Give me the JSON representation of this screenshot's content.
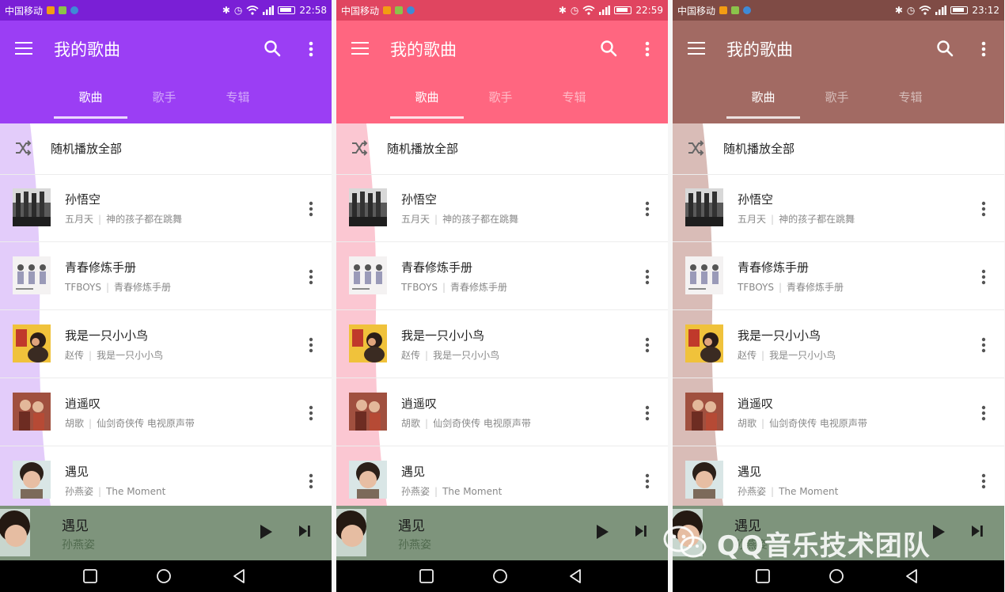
{
  "watermark": "QQ音乐技术团队",
  "phones": [
    {
      "theme": {
        "primary": "#9b3ef4",
        "status": "#7a1fd6",
        "wave": "#e3ccfa"
      },
      "status": {
        "carrier": "中国移动",
        "time": "22:58"
      },
      "toolbar": {
        "title": "我的歌曲"
      },
      "tabs": [
        "歌曲",
        "歌手",
        "专辑"
      ],
      "shuffle_label": "随机播放全部",
      "songs": [
        {
          "title": "孙悟空",
          "artist": "五月天",
          "album": "神的孩子都在跳舞"
        },
        {
          "title": "青春修炼手册",
          "artist": "TFBOYS",
          "album": "青春修炼手册"
        },
        {
          "title": "我是一只小小鸟",
          "artist": "赵传",
          "album": "我是一只小小鸟"
        },
        {
          "title": "逍遥叹",
          "artist": "胡歌",
          "album": "仙剑奇侠传 电视原声带"
        },
        {
          "title": "遇见",
          "artist": "孙燕姿",
          "album": "The Moment"
        }
      ],
      "player": {
        "title": "遇见",
        "artist": "孙燕姿"
      }
    },
    {
      "theme": {
        "primary": "#ff6680",
        "status": "#e04560",
        "wave": "#fbc7d2"
      },
      "status": {
        "carrier": "中国移动",
        "time": "22:59"
      },
      "toolbar": {
        "title": "我的歌曲"
      },
      "tabs": [
        "歌曲",
        "歌手",
        "专辑"
      ],
      "shuffle_label": "随机播放全部",
      "songs": [
        {
          "title": "孙悟空",
          "artist": "五月天",
          "album": "神的孩子都在跳舞"
        },
        {
          "title": "青春修炼手册",
          "artist": "TFBOYS",
          "album": "青春修炼手册"
        },
        {
          "title": "我是一只小小鸟",
          "artist": "赵传",
          "album": "我是一只小小鸟"
        },
        {
          "title": "逍遥叹",
          "artist": "胡歌",
          "album": "仙剑奇侠传 电视原声带"
        },
        {
          "title": "遇见",
          "artist": "孙燕姿",
          "album": "The Moment"
        }
      ],
      "player": {
        "title": "遇见",
        "artist": "孙燕姿"
      }
    },
    {
      "theme": {
        "primary": "#a26a63",
        "status": "#7f4b45",
        "wave": "#d9bcb7"
      },
      "status": {
        "carrier": "中国移动",
        "time": "23:12"
      },
      "toolbar": {
        "title": "我的歌曲"
      },
      "tabs": [
        "歌曲",
        "歌手",
        "专辑"
      ],
      "shuffle_label": "随机播放全部",
      "songs": [
        {
          "title": "孙悟空",
          "artist": "五月天",
          "album": "神的孩子都在跳舞"
        },
        {
          "title": "青春修炼手册",
          "artist": "TFBOYS",
          "album": "青春修炼手册"
        },
        {
          "title": "我是一只小小鸟",
          "artist": "赵传",
          "album": "我是一只小小鸟"
        },
        {
          "title": "逍遥叹",
          "artist": "胡歌",
          "album": "仙剑奇侠传 电视原声带"
        },
        {
          "title": "遇见",
          "artist": "孙燕姿",
          "album": "The Moment"
        }
      ],
      "player": {
        "title": "遇见",
        "artist": "孙燕姿"
      }
    }
  ]
}
